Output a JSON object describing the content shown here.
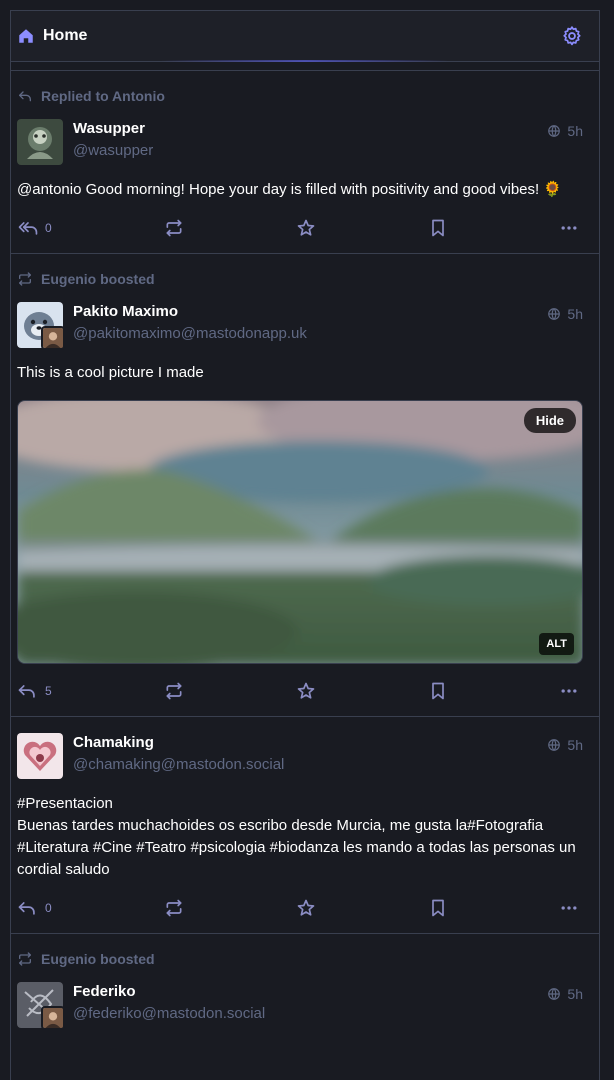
{
  "header": {
    "title": "Home",
    "home_icon": "home-icon",
    "settings_icon": "gear-icon"
  },
  "colors": {
    "accent": "#8b8dc4",
    "muted": "#606984",
    "background": "#191b22",
    "border": "#393f4f"
  },
  "statuses": [
    {
      "prepend": "Replied to Antonio",
      "prepend_icon": "reply-icon",
      "display_name": "Wasupper",
      "acct": "@wasupper",
      "time": "5h",
      "content_mention": "@antonio",
      "content_text": " Good morning! Hope your day is filled with positivity and good vibes! 🌻",
      "replies": "0"
    },
    {
      "prepend": "Eugenio boosted",
      "prepend_icon": "boost-icon",
      "display_name": "Pakito Maximo",
      "acct": "@pakitomaximo@mastodonapp.uk",
      "time": "5h",
      "content_text": "This is a cool picture I made",
      "media": {
        "hide_label": "Hide",
        "alt_label": "ALT"
      },
      "replies": "5"
    },
    {
      "display_name": "Chamaking",
      "acct": "@chamaking@mastodon.social",
      "time": "5h",
      "content_line1": "#Presentacion",
      "content_line2_a": "Buenas tardes muchachoides os escribo desde Murcia, me gusta la",
      "content_line2_b": "#Fotografia",
      "content_line3_tags": "#Literatura #Cine #Teatro #psicologia #biodanza",
      "content_line3_text": " les mando a todas las personas un",
      "content_line4": "cordial saludo",
      "replies": "0"
    },
    {
      "prepend": "Eugenio boosted",
      "prepend_icon": "boost-icon",
      "display_name": "Federiko",
      "acct": "@federiko@mastodon.social",
      "time": "5h"
    }
  ]
}
